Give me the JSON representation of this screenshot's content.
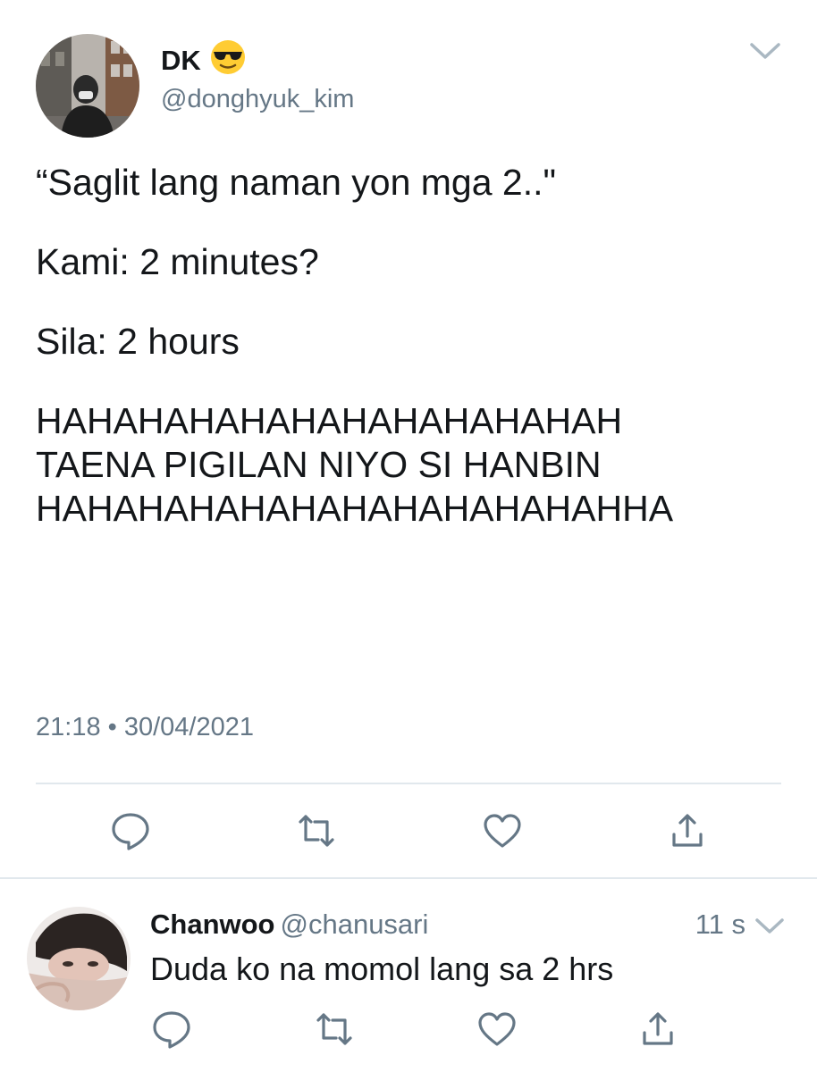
{
  "tweet": {
    "display_name": "DK",
    "name_emoji": "smiling-face-with-sunglasses",
    "handle": "@donghyuk_kim",
    "lines": [
      "“Saglit lang naman yon mga 2..\"",
      "Kami: 2 minutes?",
      "Sila: 2 hours",
      "HAHAHAHAHAHAHAHAHAHAHAH",
      "TAENA PIGILAN NIYO SI HANBIN",
      "HAHAHAHAHAHAHAHAHAHAHAHHA"
    ],
    "time": "21:18",
    "separator": "•",
    "date": "30/04/2021",
    "actions": [
      "comment-icon",
      "retweet-icon",
      "like-icon",
      "share-icon"
    ]
  },
  "reply": {
    "display_name": "Chanwoo",
    "handle": "@chanusari",
    "time": "11 s",
    "text": "Duda ko na momol lang sa 2 hrs",
    "actions": [
      "comment-icon",
      "retweet-icon",
      "like-icon",
      "share-icon"
    ]
  },
  "colors": {
    "text": "#14171a",
    "secondary": "#657786",
    "divider": "#e1e8ed",
    "icon": "#657786"
  }
}
